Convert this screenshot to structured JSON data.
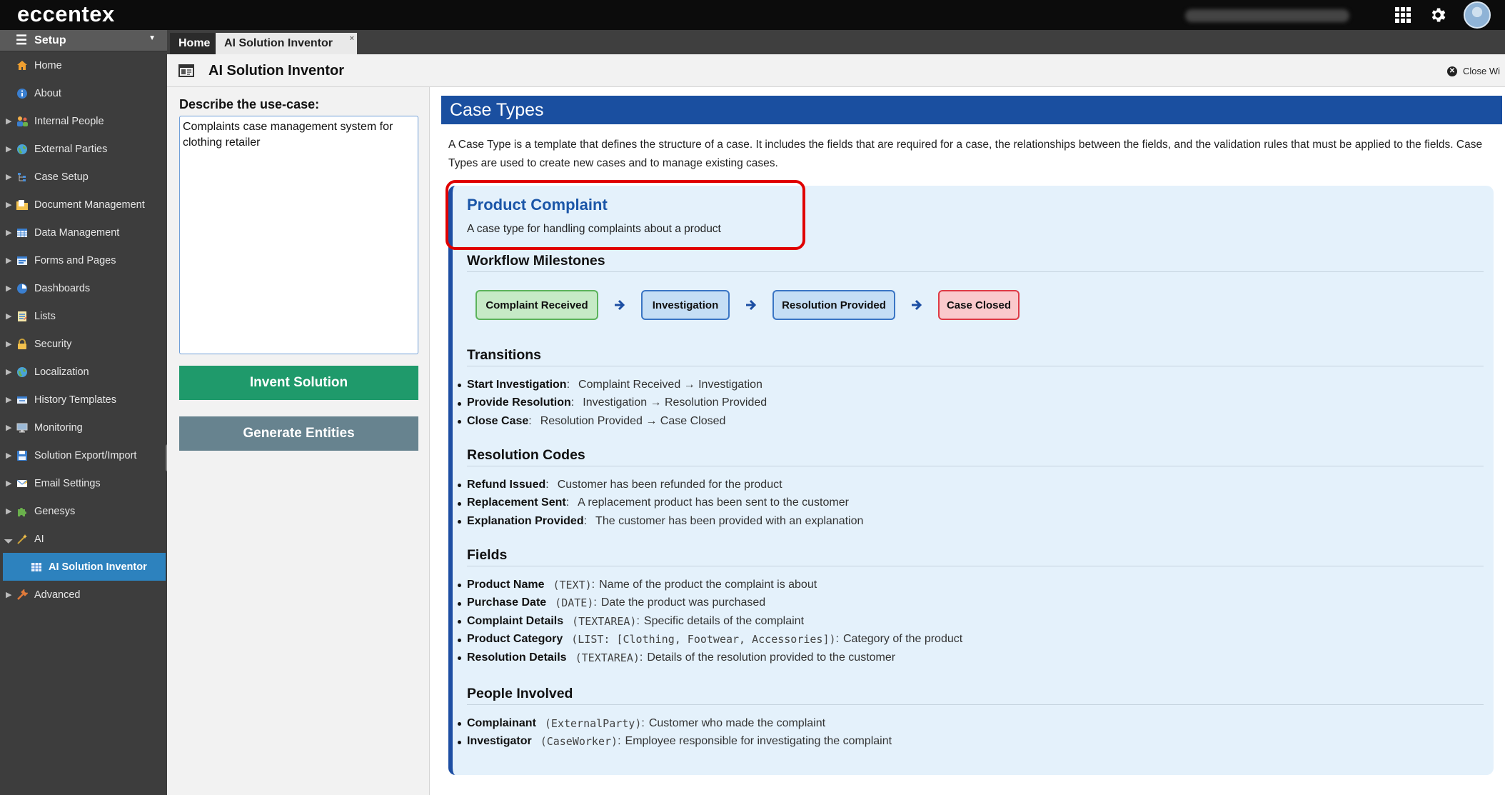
{
  "app": {
    "logo": "eccentex"
  },
  "topbar": {
    "apps_icon": "grid-icon",
    "settings_icon": "gear-icon",
    "avatar_icon": "user-avatar-icon"
  },
  "sidebar": {
    "header": "Setup",
    "items": [
      {
        "label": "Home",
        "icon": "home-icon",
        "has_arrow": false
      },
      {
        "label": "About",
        "icon": "info-icon",
        "has_arrow": false
      },
      {
        "label": "Internal People",
        "icon": "people-icon",
        "has_arrow": true
      },
      {
        "label": "External Parties",
        "icon": "globe-icon",
        "has_arrow": true
      },
      {
        "label": "Case Setup",
        "icon": "tree-icon",
        "has_arrow": true
      },
      {
        "label": "Document Management",
        "icon": "folder-icon",
        "has_arrow": true
      },
      {
        "label": "Data Management",
        "icon": "table-icon",
        "has_arrow": true
      },
      {
        "label": "Forms and Pages",
        "icon": "form-icon",
        "has_arrow": true
      },
      {
        "label": "Dashboards",
        "icon": "dashboard-icon",
        "has_arrow": true
      },
      {
        "label": "Lists",
        "icon": "list-icon",
        "has_arrow": true
      },
      {
        "label": "Security",
        "icon": "lock-icon",
        "has_arrow": true
      },
      {
        "label": "Localization",
        "icon": "globe-icon",
        "has_arrow": true
      },
      {
        "label": "History Templates",
        "icon": "history-icon",
        "has_arrow": true
      },
      {
        "label": "Monitoring",
        "icon": "monitor-icon",
        "has_arrow": true
      },
      {
        "label": "Solution Export/Import",
        "icon": "save-icon",
        "has_arrow": true
      },
      {
        "label": "Email Settings",
        "icon": "email-icon",
        "has_arrow": true
      },
      {
        "label": "Genesys",
        "icon": "puzzle-icon",
        "has_arrow": true
      },
      {
        "label": "AI",
        "icon": "wand-icon",
        "has_arrow": true
      },
      {
        "label": "AI Solution Inventor",
        "icon": "grid-table-icon",
        "has_arrow": false
      },
      {
        "label": "Advanced",
        "icon": "wrench-icon",
        "has_arrow": true
      }
    ]
  },
  "tabs": {
    "home": "Home",
    "active": "AI Solution Inventor",
    "close": "×"
  },
  "page": {
    "title": "AI Solution Inventor",
    "close_window": "Close Wi"
  },
  "left_panel": {
    "label": "Describe the use-case:",
    "use_case_value": "Complaints case management system for clothing retailer",
    "invent_button": "Invent Solution",
    "generate_button": "Generate Entities"
  },
  "content": {
    "header": "Case Types",
    "description": "A Case Type is a template that defines the structure of a case. It includes the fields that are required for a case, the relationships between the fields, and the validation rules that must be applied to the fields. Case Types are used to create new cases and to manage existing cases.",
    "case_type": {
      "name": "Product Complaint",
      "description": "A case type for handling complaints about a product",
      "sections": {
        "workflow": "Workflow Milestones",
        "transitions": "Transitions",
        "resolution_codes": "Resolution Codes",
        "fields": "Fields",
        "people": "People Involved"
      },
      "milestones": [
        "Complaint Received",
        "Investigation",
        "Resolution Provided",
        "Case Closed"
      ],
      "milestone_colors": {
        "received": "#c6eac6",
        "investigation": "#c5def5",
        "resolution": "#c5def5",
        "closed": "#fac9cc"
      },
      "transitions": [
        {
          "name": "Start Investigation",
          "text": "Complaint Received → Investigation"
        },
        {
          "name": "Provide Resolution",
          "text": "Investigation → Resolution Provided"
        },
        {
          "name": "Close Case",
          "text": "Resolution Provided → Case Closed"
        }
      ],
      "resolution_codes": [
        {
          "name": "Refund Issued",
          "text": "Customer has been refunded for the product"
        },
        {
          "name": "Replacement Sent",
          "text": "A replacement product has been sent to the customer"
        },
        {
          "name": "Explanation Provided",
          "text": "The customer has been provided with an explanation"
        }
      ],
      "fields": [
        {
          "name": "Product Name",
          "type": "(TEXT)",
          "text": "Name of the product the complaint is about"
        },
        {
          "name": "Purchase Date",
          "type": "(DATE)",
          "text": "Date the product was purchased"
        },
        {
          "name": "Complaint Details",
          "type": "(TEXTAREA)",
          "text": "Specific details of the complaint"
        },
        {
          "name": "Product Category",
          "type": "(LIST: [Clothing, Footwear, Accessories])",
          "text": "Category of the product"
        },
        {
          "name": "Resolution Details",
          "type": "(TEXTAREA)",
          "text": "Details of the resolution provided to the customer"
        }
      ],
      "people": [
        {
          "name": "Complainant",
          "type": "(ExternalParty)",
          "text": "Customer who made the complaint"
        },
        {
          "name": "Investigator",
          "type": "(CaseWorker)",
          "text": "Employee responsible for investigating the complaint"
        }
      ]
    }
  }
}
